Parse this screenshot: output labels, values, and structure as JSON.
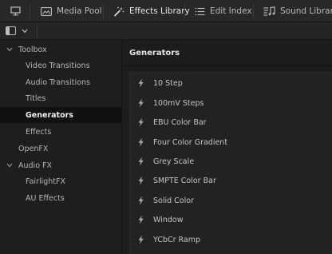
{
  "tabs": [
    {
      "label": "",
      "icon": "monitor-icon"
    },
    {
      "label": "Media Pool",
      "icon": "media-pool-icon"
    },
    {
      "label": "Effects Library",
      "icon": "magic-wand-icon",
      "active": true
    },
    {
      "label": "Edit Index",
      "icon": "list-icon"
    },
    {
      "label": "Sound Library",
      "icon": "music-note-icon"
    }
  ],
  "toolbar": {
    "toggle_icon": "panel-toggle-icon",
    "menu_icon": "chevron-down-icon"
  },
  "sidebar": {
    "items": [
      {
        "label": "Toolbox",
        "expanded": true
      },
      {
        "label": "Video Transitions"
      },
      {
        "label": "Audio Transitions"
      },
      {
        "label": "Titles"
      },
      {
        "label": "Generators",
        "selected": true
      },
      {
        "label": "Effects"
      },
      {
        "label": "OpenFX"
      },
      {
        "label": "Audio FX",
        "expanded": true
      },
      {
        "label": "FairlightFX"
      },
      {
        "label": "AU Effects"
      }
    ]
  },
  "main": {
    "title": "Generators",
    "items": [
      "10 Step",
      "100mV Steps",
      "EBU Color Bar",
      "Four Color Gradient",
      "Grey Scale",
      "SMPTE Color Bar",
      "Solid Color",
      "Window",
      "YCbCr Ramp"
    ]
  },
  "colors": {
    "background": "#1e1e1f",
    "selected_row": "#111112",
    "text": "#c8c8c8"
  }
}
